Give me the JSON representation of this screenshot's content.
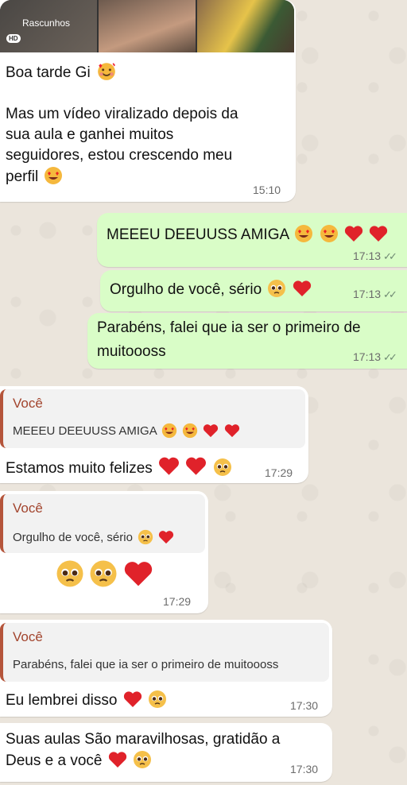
{
  "media_header": {
    "album_label": "Rascunhos",
    "hd_badge": "HD"
  },
  "messages": [
    {
      "id": "m1",
      "dir": "in",
      "lines": [
        "Boa tarde Gi",
        "",
        "Mas um vídeo viralizado depois da",
        "sua aula e ganhei muitos",
        "seguidores, estou crescendo meu",
        "perfil"
      ],
      "time": "15:10"
    },
    {
      "id": "m2",
      "dir": "out",
      "text": "MEEEU DEEUUSS AMIGA",
      "time": "17:13"
    },
    {
      "id": "m3",
      "dir": "out",
      "text": "Orgulho de você, sério",
      "time": "17:13"
    },
    {
      "id": "m4",
      "dir": "out",
      "lines": [
        "Parabéns, falei que ia ser o primeiro de",
        "muitoooss"
      ],
      "time": "17:13"
    },
    {
      "id": "m5",
      "dir": "in",
      "quote_author": "Você",
      "quote_text": "MEEEU DEEUUSS AMIGA",
      "text": "Estamos muito felizes",
      "time": "17:29"
    },
    {
      "id": "m6",
      "dir": "in",
      "quote_author": "Você",
      "quote_text": "Orgulho de você, sério",
      "time": "17:29"
    },
    {
      "id": "m7",
      "dir": "in",
      "quote_author": "Você",
      "quote_text": "Parabéns, falei que ia ser o primeiro de muitoooss",
      "text": "Eu lembrei disso",
      "time": "17:30"
    },
    {
      "id": "m8",
      "dir": "in",
      "lines": [
        "Suas aulas São maravilhosas, gratidão a",
        "Deus e a você"
      ],
      "time": "17:30"
    }
  ],
  "colors": {
    "incoming_bubble": "#ffffff",
    "outgoing_bubble": "#d9fdc7",
    "quote_accent": "#b5553b",
    "read_ticks": "#6f8a73"
  },
  "icons": [
    "smiling-face-with-hearts-icon",
    "heart-eyes-icon",
    "red-heart-icon",
    "pleading-face-icon",
    "double-check-icon"
  ]
}
